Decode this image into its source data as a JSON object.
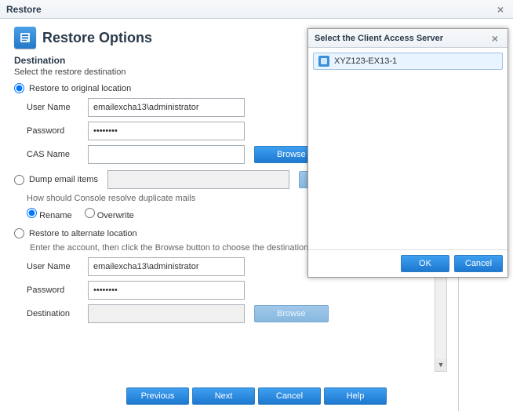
{
  "titlebar": {
    "title": "Restore"
  },
  "header": {
    "title": "Restore Options"
  },
  "destination": {
    "heading": "Destination",
    "subtitle": "Select the restore destination",
    "restore_original": {
      "label": "Restore to original location",
      "user_label": "User Name",
      "user_value": "emailexcha13\\administrator",
      "password_label": "Password",
      "password_value": "••••••••",
      "cas_label": "CAS Name",
      "cas_value": "",
      "browse_btn": "Browse"
    },
    "dump": {
      "label": "Dump email items",
      "path_value": "",
      "dup_hint": "How should Console resolve duplicate mails",
      "rename": "Rename",
      "overwrite": "Overwrite"
    },
    "restore_alt": {
      "label": "Restore to alternate location",
      "hint": "Enter the account, then click the Browse button to choose the destination.",
      "user_label": "User Name",
      "user_value": "emailexcha13\\administrator",
      "password_label": "Password",
      "password_value": "••••••••",
      "dest_label": "Destination",
      "dest_value": "",
      "browse_btn": "Browse"
    }
  },
  "footer": {
    "previous": "Previous",
    "next": "Next",
    "cancel": "Cancel",
    "help": "Help"
  },
  "popup": {
    "title": "Select the Client Access Server",
    "item": "XYZ123-EX13-1",
    "ok": "OK",
    "cancel": "Cancel"
  }
}
